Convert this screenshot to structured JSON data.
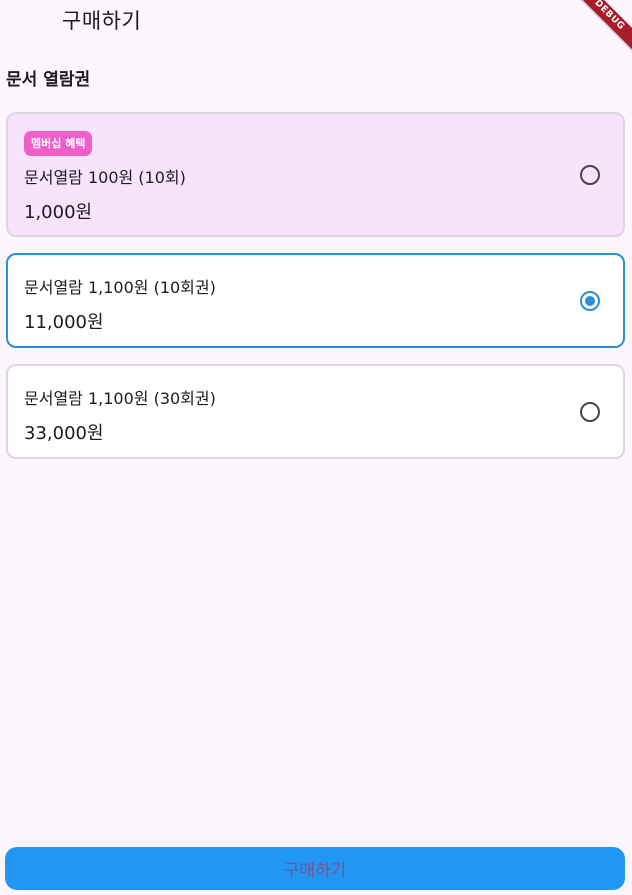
{
  "appbar": {
    "title": "구매하기"
  },
  "debug_banner": "DEBUG",
  "section": {
    "title": "문서 열람권"
  },
  "options": [
    {
      "badge": "멤버십 혜택",
      "name": "문서열람 100원 (10회)",
      "price": "1,000원",
      "selected": false,
      "highlighted": true
    },
    {
      "name": "문서열람 1,100원 (10회권)",
      "price": "11,000원",
      "selected": true,
      "highlighted": false
    },
    {
      "name": "문서열람 1,100원 (30회권)",
      "price": "33,000원",
      "selected": false,
      "highlighted": false
    }
  ],
  "buy_button": {
    "label": "구매하기"
  },
  "colors": {
    "background": "#fdf6fe",
    "highlight_card": "#f8e3fd",
    "badge": "#ef5fcb",
    "accent": "#2196f3",
    "selected_border": "#2b8fd6"
  }
}
